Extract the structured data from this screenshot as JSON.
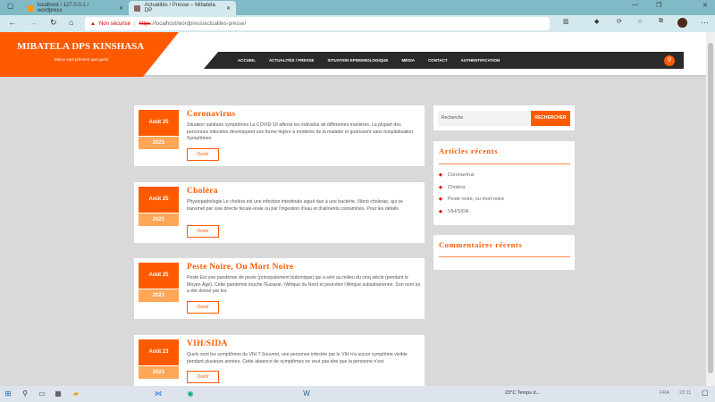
{
  "browser": {
    "tabs": [
      {
        "label": "localhost / 127.0.0.1 / wordpress"
      },
      {
        "label": "Actualités / Presse – Mibatela DP"
      }
    ],
    "security": "Non sécurisé",
    "url_scheme": "https",
    "url_rest": "://localhost/wordpress/actualites-presse/"
  },
  "site": {
    "title": "MIBATELA DPS KINSHASA",
    "tagline": "Mieux vaut prévenir que guérir",
    "menu": [
      "ACCUEIL",
      "ACTUALITÉS / PRESSE",
      "SITUATION EPIDEMIOLOGIQUE",
      "MÉDIA",
      "CONTACT",
      "AUTHENTIFICATION"
    ]
  },
  "posts": [
    {
      "day": "Août 25",
      "year": "2021",
      "title": "Coronavirus",
      "excerpt": "Situation sanitaire symptômes La COVID-19 affecte les individus de différentes manières. La plupart des personnes infectées développent une forme légère à modérée de la maladie et guérissent sans hospitalisation. Symptômes",
      "button": "Ouvrir"
    },
    {
      "day": "Août 25",
      "year": "2021",
      "title": "Choléra",
      "excerpt": "Physiopathologie Le choléra est une infection intestinale aiguë due à une bactérie, Vibrio cholerae, qui se transmet par voie directe fécale-orale ou par l'ingestion d'eau et d'aliments contaminés. Pour les détails",
      "button": "Ouvrir"
    },
    {
      "day": "Août 25",
      "year": "2021",
      "title": "Peste Noire, Ou Mort Noire",
      "excerpt": "Peste Est une pandémie de peste (principalement bubonique) qui a sévi au milieu du cinq siècle (pendant le Moyen Âge). Cette pandémie touche l'Eurasie, l'Afrique du Nord et peut-être l'Afrique subsaharienne. Son nom lui a été donné par les",
      "button": "Ouvrir"
    },
    {
      "day": "Août 23",
      "year": "2021",
      "title": "VIH/SIDA",
      "excerpt": "Quels sont les symptômes du VIH ? Souvent, une personne infectée par le VIH n'a aucun symptôme visible pendant plusieurs années. Cette absence de symptômes ne veut pas dire que la personne n'est",
      "button": "Ouvrir"
    }
  ],
  "sidebar": {
    "search_placeholder": "Recherche",
    "search_button": "RECHERCHER",
    "recent_title": "Articles récents",
    "recent": [
      "Coronavirus",
      "Choléra",
      "Peste noire, ou mort noire",
      "VIH/SIDA"
    ],
    "comments_title": "Commentaires récents"
  },
  "taskbar": {
    "weather": "23°C  Temps d...",
    "lang": "FRA",
    "time": "23:11"
  }
}
